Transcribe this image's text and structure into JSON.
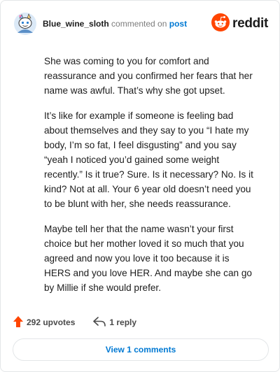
{
  "comment": {
    "username": "Blue_wine_sloth",
    "action_text": "commented on",
    "post_link": "post",
    "paragraphs": [
      "She was coming to you for comfort and reassurance and you confirmed her fears that her name was awful. That’s why she got upset.",
      "It’s like for example if someone is feeling bad about themselves and they say to you “I hate my body, I’m so fat, I feel disgusting” and you say “yeah I noticed you’d gained some weight recently.” Is it true? Sure. Is it necessary? No. Is it kind? Not at all. Your 6 year old doesn’t need you to be blunt with her, she needs reassurance.",
      "Maybe tell her that the name wasn’t your first choice but her mother loved it so much that you agreed and now you love it too because it is HERS and you love HER. And maybe she can go by Millie if she would prefer."
    ],
    "upvotes": "292 upvotes",
    "replies": "1 reply",
    "view_comments": "View 1 comments"
  },
  "brand": {
    "wordmark": "reddit",
    "color": "#ff4500"
  },
  "icons": {
    "avatar": "snoo-avatar-icon",
    "logo": "reddit-logo-icon",
    "upvote": "upvote-arrow-icon",
    "reply": "reply-arrow-icon"
  },
  "colors": {
    "link": "#0079d3",
    "upvote": "#ff4500",
    "text": "#1c1c1c",
    "muted": "#7c7c7c"
  }
}
